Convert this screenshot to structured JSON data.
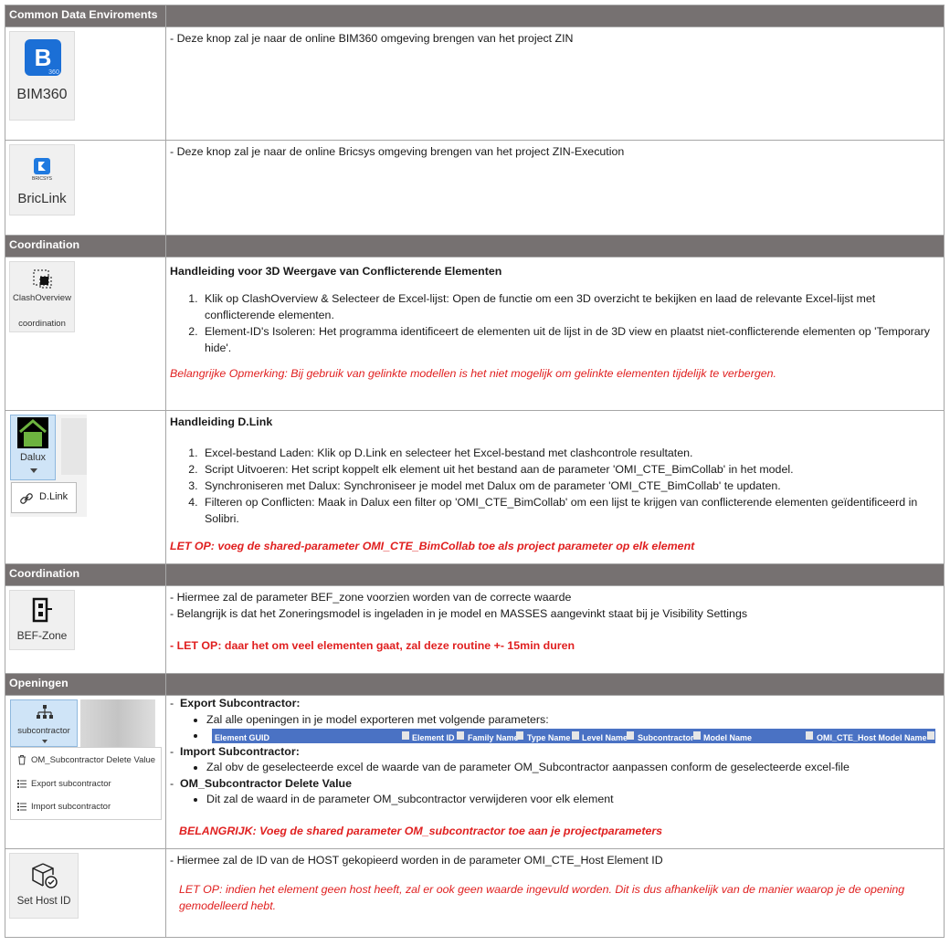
{
  "sections": {
    "cde": "Common Data Enviroments",
    "coordination1": "Coordination",
    "coordination2": "Coordination",
    "openingen": "Openingen"
  },
  "icons": {
    "bim360": "BIM360",
    "bim360_badge": "360",
    "briclink": "BricLink",
    "bricsys_small": "BRICSYS",
    "clash_title": "ClashOverview",
    "clash_sub": "coordination",
    "dalux": "Dalux",
    "dlink": "D.Link",
    "befzone": "BEF-Zone",
    "subcontractor": "subcontractor",
    "menu_delete": "OM_Subcontractor Delete Value",
    "menu_export": "Export subcontractor",
    "menu_import": "Import subcontractor",
    "sethost": "Set Host ID"
  },
  "rows": {
    "bim360_text": "-  Deze knop zal je naar de online BIM360 omgeving brengen van het project ZIN",
    "briclink_text": "-  Deze knop zal je naar de online Bricsys omgeving brengen van het project ZIN-Execution",
    "clash_heading": "Handleiding voor 3D Weergave van Conflicterende Elementen",
    "clash_steps": [
      "Klik op ClashOverview & Selecteer de Excel-lijst: Open de functie om een 3D overzicht te bekijken en laad de relevante Excel-lijst met conflicterende elementen.",
      "Element-ID's Isoleren: Het programma identificeert de elementen uit de lijst in de 3D view en plaatst niet-conflicterende elementen op 'Temporary hide'."
    ],
    "clash_note": "Belangrijke Opmerking: Bij gebruik van gelinkte modellen is het niet mogelijk om gelinkte elementen tijdelijk te verbergen.",
    "dlink_heading": "Handleiding D.Link",
    "dlink_steps": [
      "Excel-bestand Laden: Klik op  D.Link en selecteer het Excel-bestand met clashcontrole resultaten.",
      "Script Uitvoeren: Het script koppelt elk element uit het bestand aan de parameter 'OMI_CTE_BimCollab' in het model.",
      "Synchroniseren met Dalux: Synchroniseer je model met Dalux om de parameter 'OMI_CTE_BimCollab' te updaten.",
      "Filteren op Conflicten: Maak in Dalux een filter op 'OMI_CTE_BimCollab' om een lijst te krijgen van conflicterende elementen geïdentificeerd in Solibri."
    ],
    "dlink_note": "LET OP: voeg de shared-parameter OMI_CTE_BimCollab toe als project parameter op elk element",
    "bef_line1": "-  Hiermee zal de parameter BEF_zone voorzien worden van de correcte waarde",
    "bef_line2": "-  Belangrijk is dat het Zoneringsmodel is ingeladen in je model en MASSES aangevinkt staat bij je Visibility Settings",
    "bef_note": "-  LET OP: daar het om veel elementen gaat, zal deze routine +- 15min duren",
    "open_dash1": "-",
    "open_export_title": "Export Subcontractor:",
    "open_export_bullet": "Zal alle openingen in je model exporteren met volgende parameters:",
    "open_columns": [
      "Element GUID",
      "Element ID",
      "Family Name",
      "Type Name",
      "Level Name",
      "Subcontractor",
      "Model Name",
      "OMI_CTE_Host Model Name"
    ],
    "open_dash2": "-",
    "open_import_title": "Import Subcontractor:",
    "open_import_bullet": "Zal obv de geselecteerde excel de waarde van de parameter OM_Subcontractor aanpassen conform de geselecteerde excel-file",
    "open_dash3": "-",
    "open_delete_title": "OM_Subcontractor Delete Value",
    "open_delete_bullet": "Dit zal de waard in de parameter OM_subcontractor verwijderen voor elk element",
    "open_note": "BELANGRIJK: Voeg de shared parameter OM_subcontractor toe aan je projectparameters",
    "host_line": "-  Hiermee zal de ID van de HOST gekopieerd worden in de parameter OMI_CTE_Host Element ID",
    "host_note": "LET OP: indien het element geen host heeft, zal er ook geen waarde ingevuld worden. Dit is dus afhankelijk van de manier waarop je de opening gemodelleerd hebt."
  },
  "colors": {
    "header_bg": "#767171",
    "note_red": "#e02020",
    "excel_blue": "#4a72c4",
    "dalux_green": "#6db33f"
  }
}
